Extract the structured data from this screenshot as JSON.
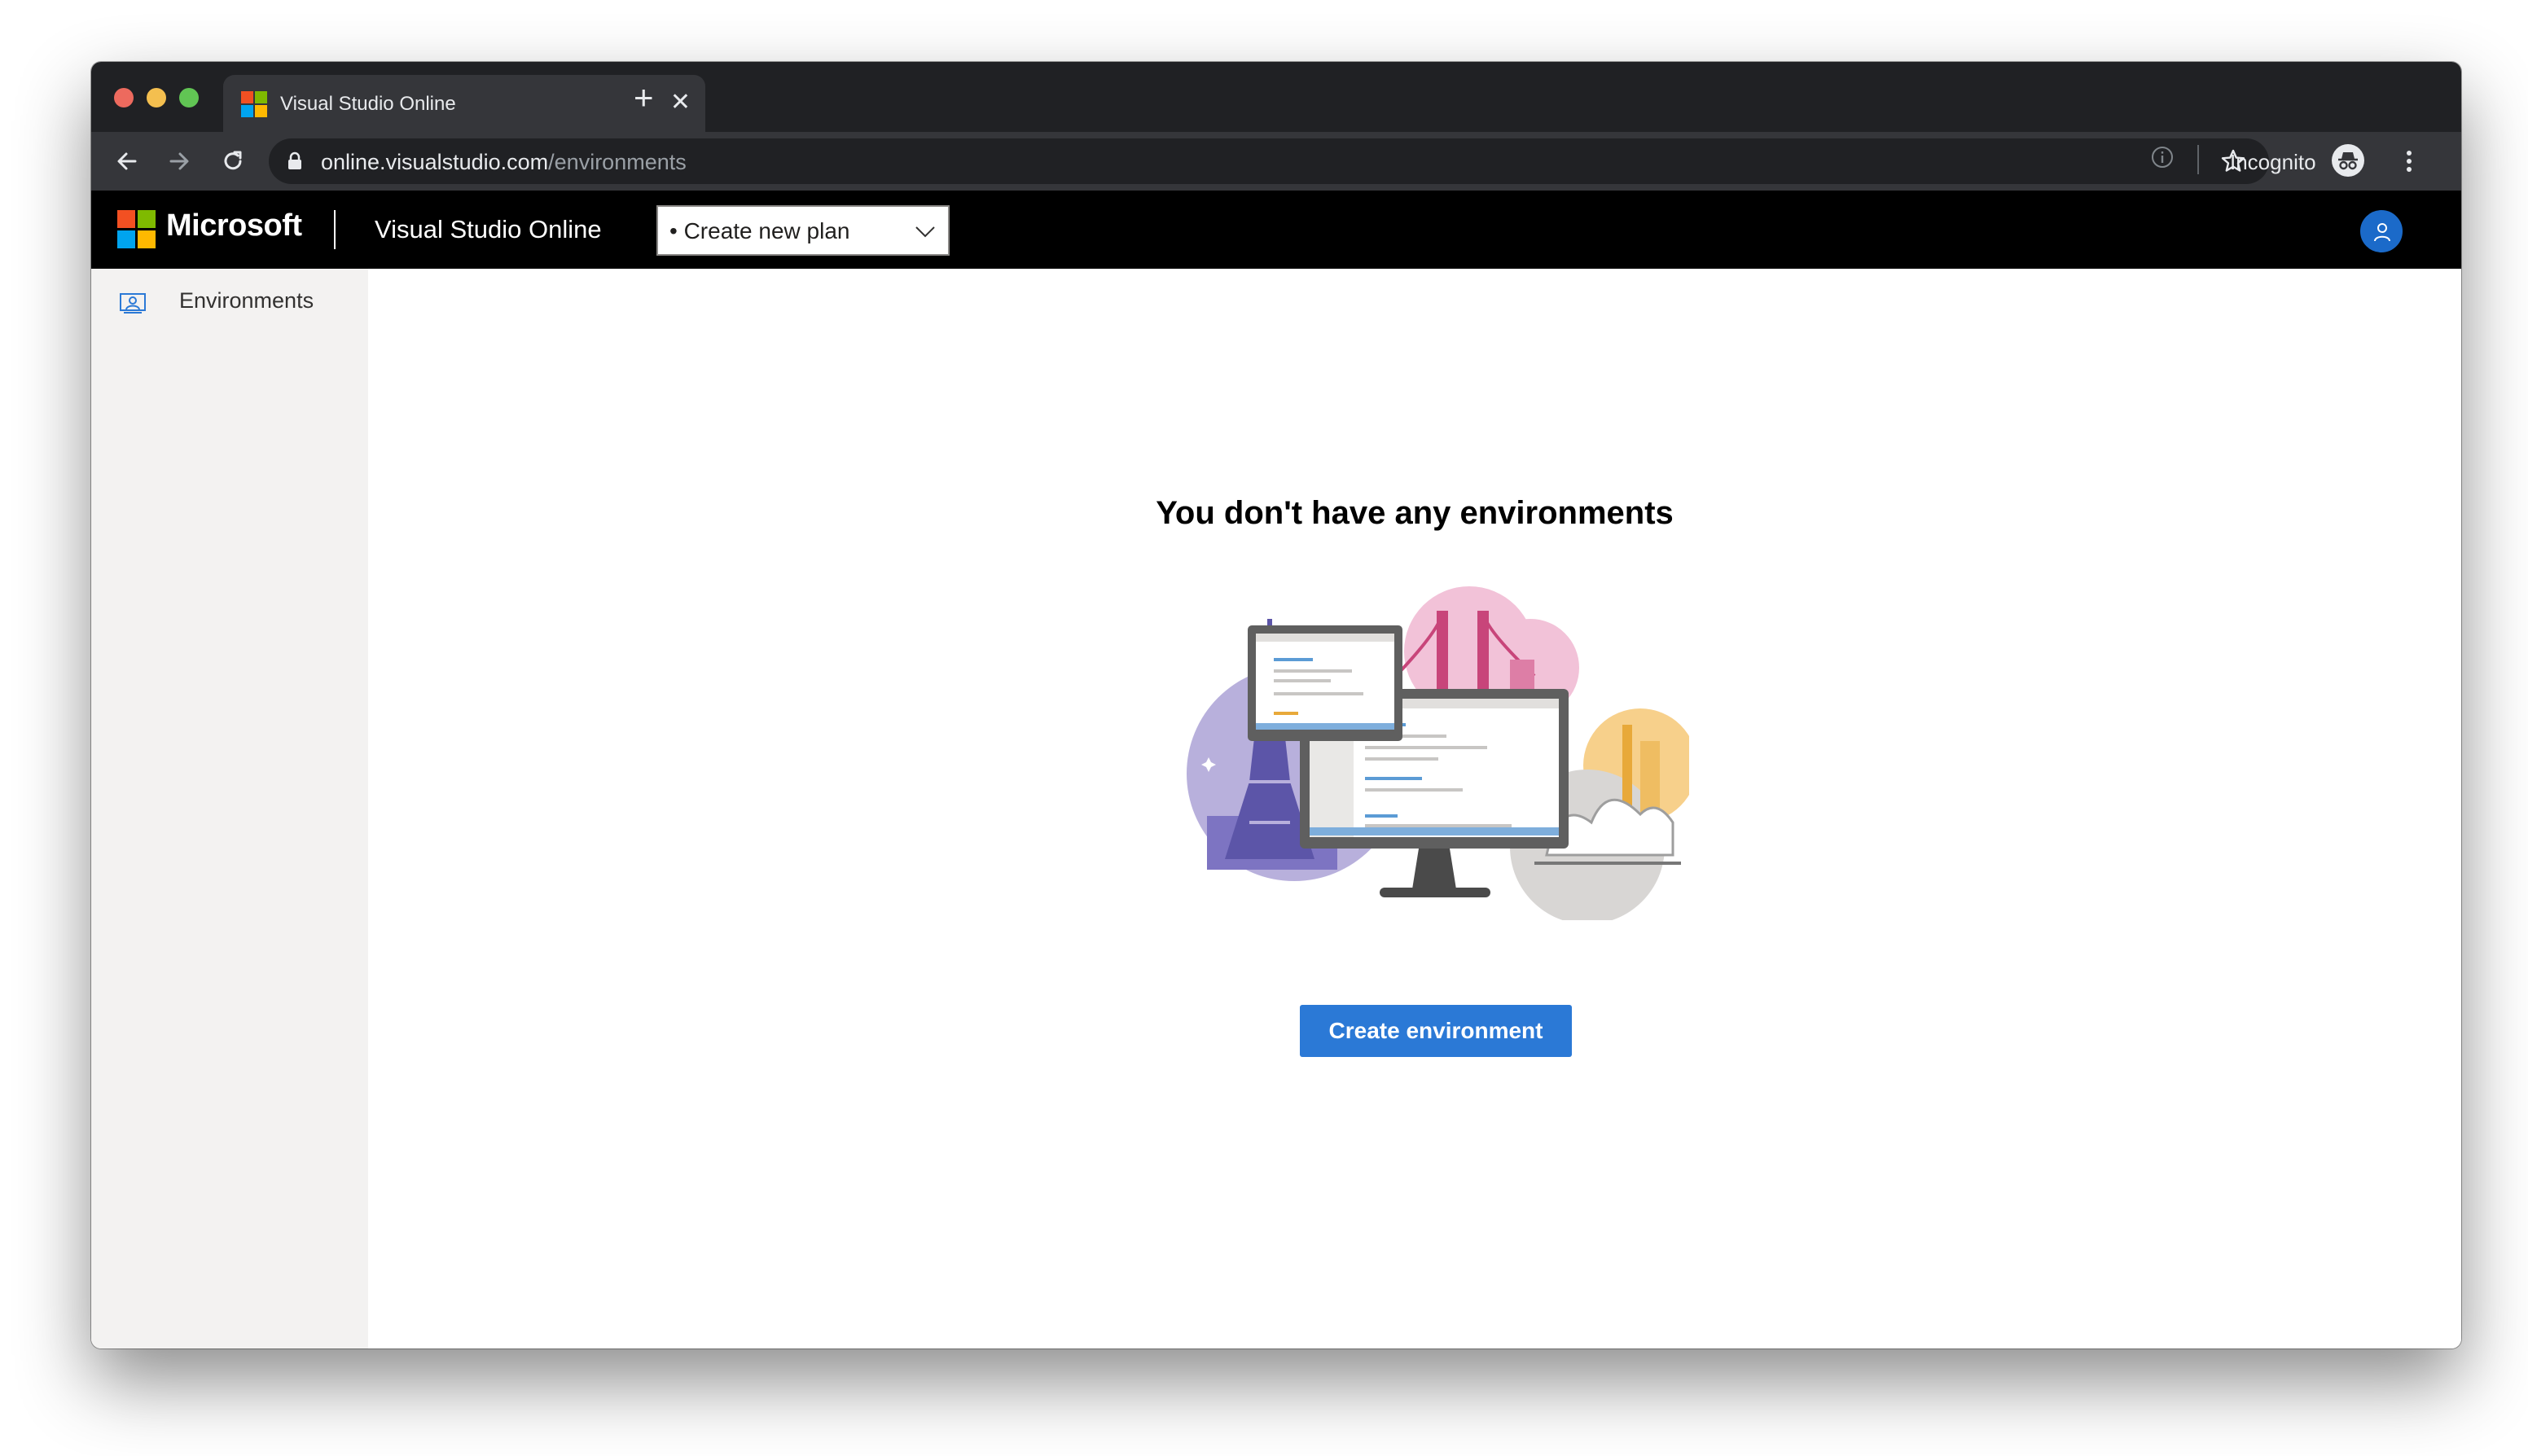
{
  "browser": {
    "tab_title": "Visual Studio Online",
    "new_tab_symbol": "+",
    "close_symbol": "✕",
    "url_domain": "online.visualstudio.com",
    "url_path": "/environments",
    "incognito_label": "Incognito",
    "icons": [
      "back-icon",
      "forward-icon",
      "reload-icon",
      "lock-icon",
      "star-icon",
      "info-icon",
      "incognito-icon",
      "more-menu-icon"
    ]
  },
  "header": {
    "brand": "Microsoft",
    "app_name": "Visual Studio Online",
    "plan_select_value": "• Create new plan",
    "colors": {
      "background": "#000000",
      "avatar": "#1b6ac9"
    }
  },
  "sidebar": {
    "items": [
      {
        "label": "Environments",
        "icon": "environments-icon"
      }
    ]
  },
  "main": {
    "empty_title": "You don't have any environments",
    "create_button_label": "Create environment",
    "colors": {
      "primary": "#2b79d6"
    }
  }
}
